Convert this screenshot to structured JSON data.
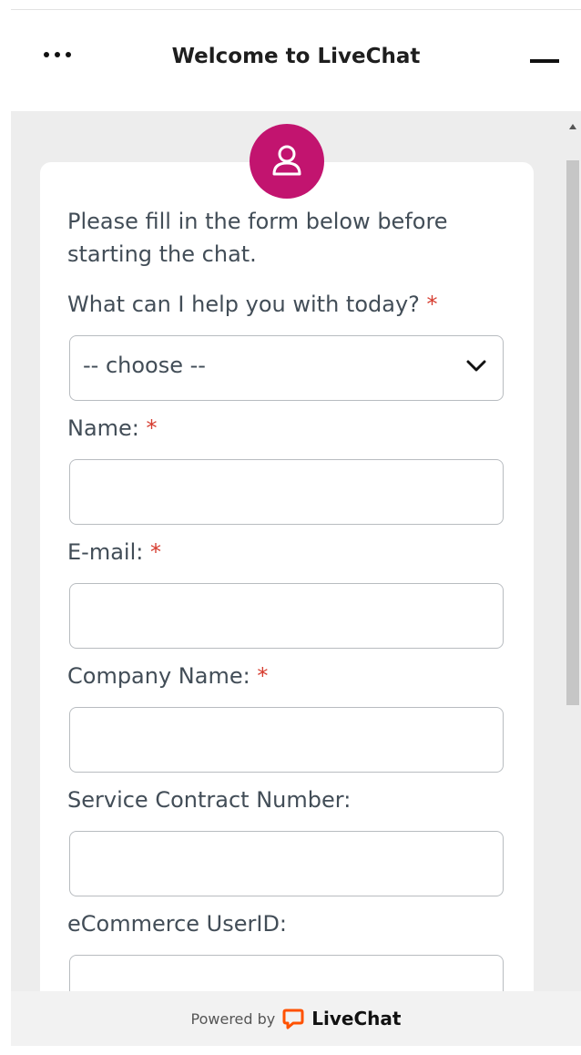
{
  "header": {
    "menu_icon": "more-horizontal-icon",
    "title": "Welcome to LiveChat",
    "minimize_icon": "minimize-icon"
  },
  "card": {
    "avatar_icon": "user-icon",
    "avatar_color": "#c2146f",
    "intro": [
      "Please fill in the form below before",
      "starting the chat."
    ],
    "required_marker": "*"
  },
  "form": {
    "topic_label": "What can I help you with today?",
    "topic_value": "-- choose --",
    "name_label": "Name:",
    "name_value": "",
    "email_label": "E-mail:",
    "email_value": "",
    "company_label": "Company Name:",
    "company_value": "",
    "contract_label": "Service Contract Number:",
    "contract_value": "",
    "userid_label": "eCommerce UserID:",
    "userid_value": ""
  },
  "footer": {
    "powered_text": "Powered by",
    "brand": "LiveChat",
    "brand_color": "#ff5100"
  }
}
